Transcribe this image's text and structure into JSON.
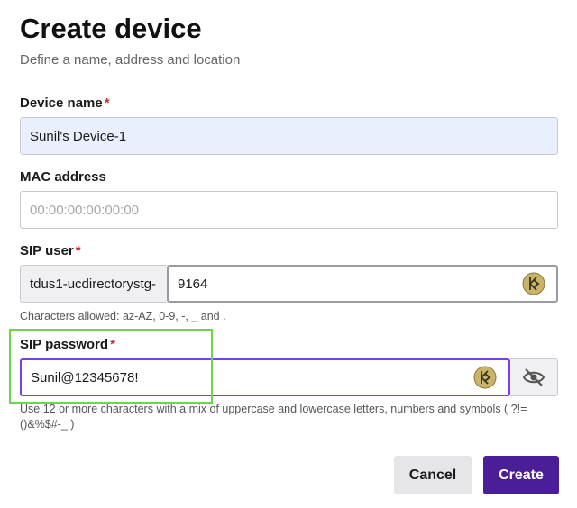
{
  "page": {
    "title": "Create device",
    "subtitle": "Define a name, address and location"
  },
  "fields": {
    "device_name": {
      "label": "Device name",
      "required_mark": "*",
      "value": "Sunil's Device-1"
    },
    "mac_address": {
      "label": "MAC address",
      "placeholder": "00:00:00:00:00:00"
    },
    "sip_user": {
      "label": "SIP user",
      "required_mark": "*",
      "prefix": "tdus1-ucdirectorystg-",
      "value": "9164",
      "hint": "Characters allowed: az-AZ, 0-9, -, _ and ."
    },
    "sip_password": {
      "label": "SIP password",
      "required_mark": "*",
      "value": "Sunil@12345678!",
      "hint": "Use 12 or more characters with a mix of uppercase and lowercase letters, numbers and symbols ( ?!=()&%$#-_ )"
    }
  },
  "icons": {
    "password_manager": "keeper-icon",
    "toggle_visibility": "eye-off-icon"
  },
  "colors": {
    "primary": "#4b1d96",
    "focus_border": "#7b3fe4",
    "highlight": "#6ed64a",
    "required": "#c9302c",
    "autofill_bg": "#e9effd"
  },
  "actions": {
    "cancel_label": "Cancel",
    "create_label": "Create"
  }
}
